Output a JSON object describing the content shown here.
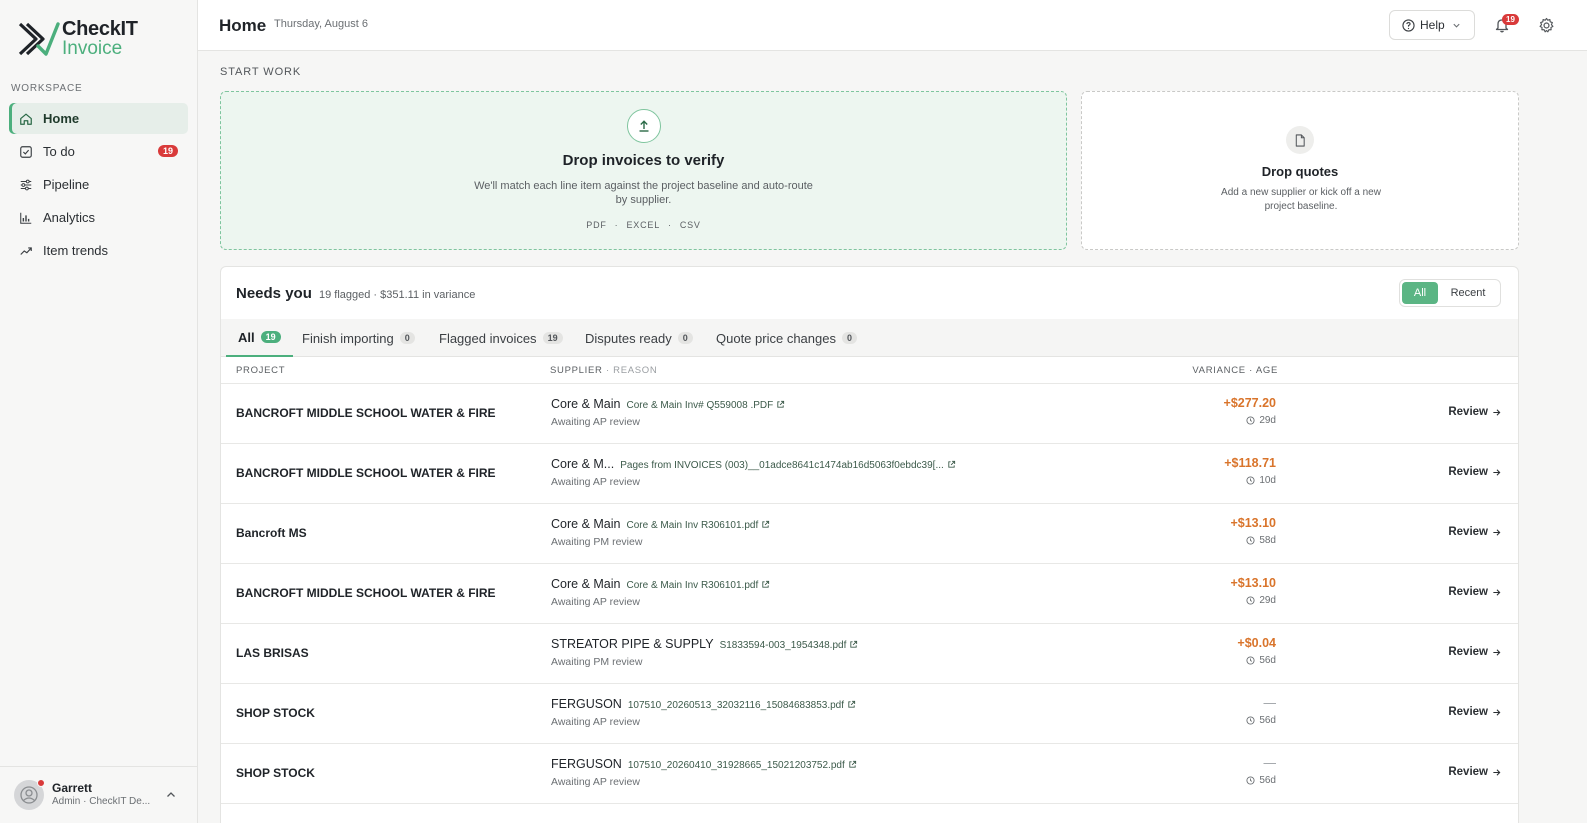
{
  "app": {
    "logo_line1": "CheckIT",
    "logo_line2": "Invoice",
    "brand_color": "#4caf7d"
  },
  "sidebar": {
    "section_label": "WORKSPACE",
    "items": [
      {
        "label": "Home",
        "icon": "home-icon",
        "active": true
      },
      {
        "label": "To do",
        "icon": "checkbox-icon",
        "badge": "19"
      },
      {
        "label": "Pipeline",
        "icon": "sliders-icon"
      },
      {
        "label": "Analytics",
        "icon": "bar-chart-icon"
      },
      {
        "label": "Item trends",
        "icon": "trend-icon"
      }
    ],
    "user": {
      "name": "Garrett",
      "role": "Admin · CheckIT De..."
    }
  },
  "header": {
    "title": "Home",
    "date": "Thursday, August 6",
    "help_label": "Help",
    "notification_count": "19"
  },
  "start_work": {
    "label": "START WORK",
    "invoices": {
      "title": "Drop invoices to verify",
      "description": "We'll match each line item against the project baseline and auto-route by supplier.",
      "formats": [
        "PDF",
        "EXCEL",
        "CSV"
      ]
    },
    "quotes": {
      "title": "Drop quotes",
      "description": "Add a new supplier or kick off a new project baseline."
    }
  },
  "needs_you": {
    "title": "Needs you",
    "subtitle": "19 flagged · $351.11 in variance",
    "filter": {
      "all": "All",
      "recent": "Recent"
    },
    "tabs": [
      {
        "label": "All",
        "count": "19",
        "active": true
      },
      {
        "label": "Finish importing",
        "count": "0"
      },
      {
        "label": "Flagged invoices",
        "count": "19"
      },
      {
        "label": "Disputes ready",
        "count": "0"
      },
      {
        "label": "Quote price changes",
        "count": "0"
      }
    ],
    "columns": {
      "project": "PROJECT",
      "supplier": "SUPPLIER",
      "reason": "· REASON",
      "variance": "VARIANCE · AGE"
    },
    "review_label": "Review",
    "rows": [
      {
        "project": "BANCROFT MIDDLE SCHOOL WATER & FIRE",
        "supplier": "Core & Main",
        "file": "Core & Main Inv# Q559008 .PDF",
        "status": "Awaiting AP review",
        "variance": "+$277.20",
        "age": "29d"
      },
      {
        "project": "BANCROFT MIDDLE SCHOOL WATER & FIRE",
        "supplier": "Core & M...",
        "file": "Pages from INVOICES (003)__01adce8641c1474ab16d5063f0ebdc39[...",
        "status": "Awaiting AP review",
        "variance": "+$118.71",
        "age": "10d"
      },
      {
        "project": "Bancroft MS",
        "supplier": "Core & Main",
        "file": "Core & Main Inv R306101.pdf",
        "status": "Awaiting PM review",
        "variance": "+$13.10",
        "age": "58d"
      },
      {
        "project": "BANCROFT MIDDLE SCHOOL WATER & FIRE",
        "supplier": "Core & Main",
        "file": "Core & Main Inv R306101.pdf",
        "status": "Awaiting AP review",
        "variance": "+$13.10",
        "age": "29d"
      },
      {
        "project": "LAS BRISAS",
        "supplier": "STREATOR PIPE & SUPPLY",
        "file": "S1833594-003_1954348.pdf",
        "status": "Awaiting PM review",
        "variance": "+$0.04",
        "age": "56d"
      },
      {
        "project": "SHOP STOCK",
        "supplier": "FERGUSON",
        "file": "107510_20260513_32032116_15084683853.pdf",
        "status": "Awaiting AP review",
        "variance": "—",
        "age": "56d"
      },
      {
        "project": "SHOP STOCK",
        "supplier": "FERGUSON",
        "file": "107510_20260410_31928665_15021203752.pdf",
        "status": "Awaiting AP review",
        "variance": "—",
        "age": "56d"
      }
    ]
  }
}
